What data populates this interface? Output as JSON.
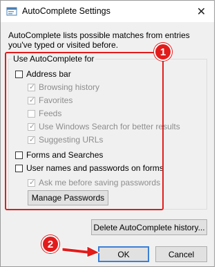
{
  "window": {
    "title": "AutoComplete Settings",
    "close_glyph": "✕"
  },
  "description": "AutoComplete lists possible matches from entries you've typed or visited before.",
  "group": {
    "label": "Use AutoComplete for",
    "items": [
      {
        "label": "Address bar",
        "checked": false,
        "enabled": true
      },
      {
        "label": "Browsing history",
        "checked": true,
        "enabled": false
      },
      {
        "label": "Favorites",
        "checked": true,
        "enabled": false
      },
      {
        "label": "Feeds",
        "checked": false,
        "enabled": false
      },
      {
        "label": "Use Windows Search for better results",
        "checked": true,
        "enabled": false
      },
      {
        "label": "Suggesting URLs",
        "checked": true,
        "enabled": false
      },
      {
        "label": "Forms and Searches",
        "checked": false,
        "enabled": true
      },
      {
        "label": "User names and passwords on forms",
        "checked": false,
        "enabled": true
      },
      {
        "label": "Ask me before saving passwords",
        "checked": true,
        "enabled": false
      }
    ],
    "manage_passwords": "Manage Passwords"
  },
  "delete_history": "Delete AutoComplete history...",
  "ok": "OK",
  "cancel": "Cancel",
  "annotations": {
    "badge1": "1",
    "badge2": "2",
    "highlight_color": "#e21b1b"
  },
  "icons": {
    "app": "autocomplete-settings-icon",
    "close": "close-icon",
    "check": "checkmark-icon",
    "arrow": "red-arrow-icon"
  }
}
